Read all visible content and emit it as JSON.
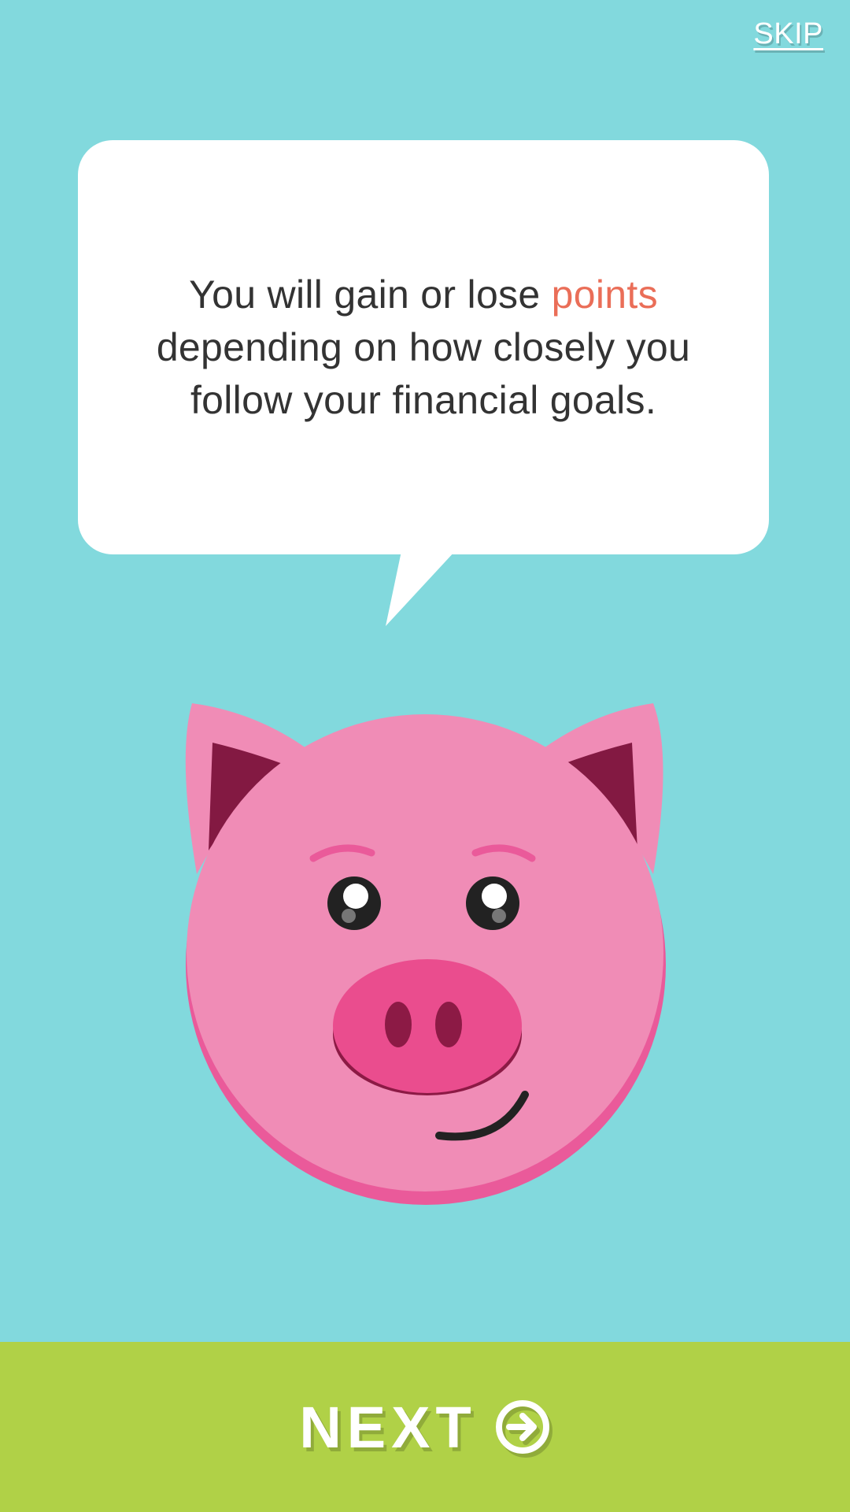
{
  "header": {
    "skip_label": "SKIP"
  },
  "bubble": {
    "line_before": "You will gain or lose ",
    "highlight": "points",
    "line_after": " depending on how closely you follow your financial goals."
  },
  "footer": {
    "next_label": "NEXT",
    "next_icon": "arrow-right-circle-icon"
  },
  "illustration": {
    "icon": "pig-mascot-icon"
  },
  "colors": {
    "background": "#82d9dd",
    "bubble": "#ffffff",
    "text": "#333333",
    "highlight": "#ea6e58",
    "next_bar": "#b0d147",
    "pig": "#f08cb6"
  }
}
